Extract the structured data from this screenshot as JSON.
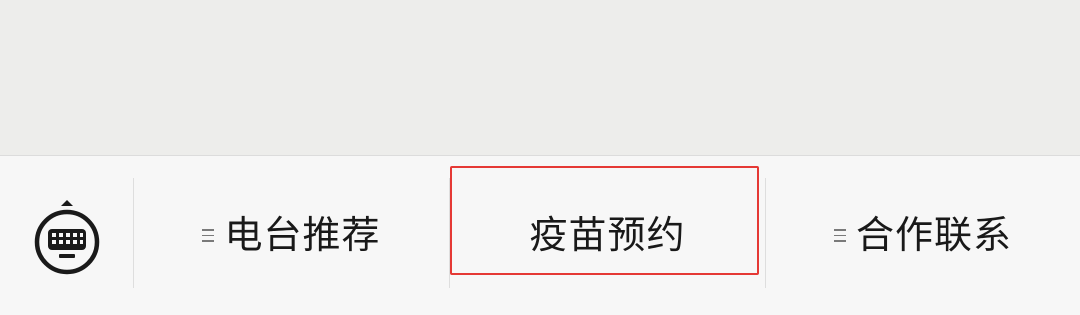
{
  "menu": {
    "keyboard_toggle": {
      "icon": "keyboard-icon"
    },
    "items": [
      {
        "label": "电台推荐",
        "has_submenu": true,
        "submenu_icon": "list-icon"
      },
      {
        "label": "疫苗预约",
        "has_submenu": false,
        "highlighted": true
      },
      {
        "label": "合作联系",
        "has_submenu": true,
        "submenu_icon": "list-icon"
      }
    ]
  },
  "colors": {
    "content_background": "#ededeb",
    "menu_background": "#f7f7f7",
    "text": "#191919",
    "highlight_border": "#e53935"
  }
}
